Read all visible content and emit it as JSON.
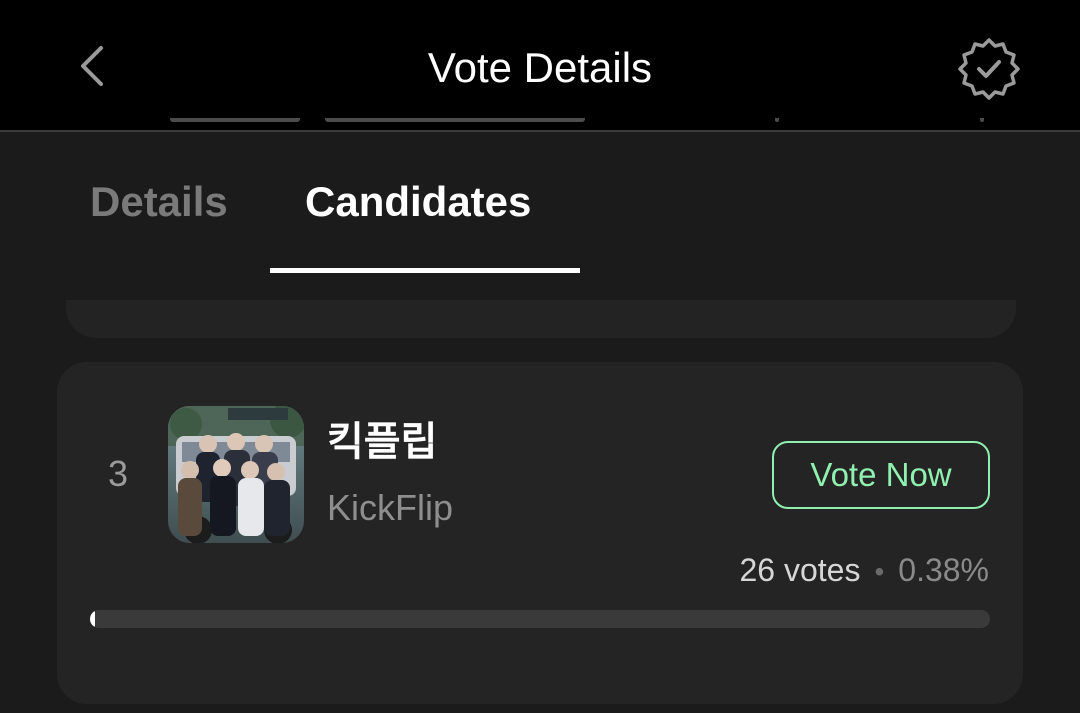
{
  "header": {
    "title": "Vote Details",
    "back_icon": "chevron-left-icon",
    "badge_icon": "verified-badge-icon"
  },
  "tabs": [
    {
      "label": "Details",
      "active": false
    },
    {
      "label": "Candidates",
      "active": true
    }
  ],
  "candidate": {
    "rank": "3",
    "name_kr": "킥플립",
    "name_en": "KickFlip",
    "vote_button": "Vote Now",
    "votes_text": "26 votes",
    "separator": "•",
    "percent_text": "0.38%",
    "progress_percent": 0.38,
    "avatar_icon": "group-photo-thumbnail"
  },
  "colors": {
    "accent": "#8ff0b0",
    "background": "#1b1b1b",
    "card": "#242424",
    "header": "#000000"
  }
}
